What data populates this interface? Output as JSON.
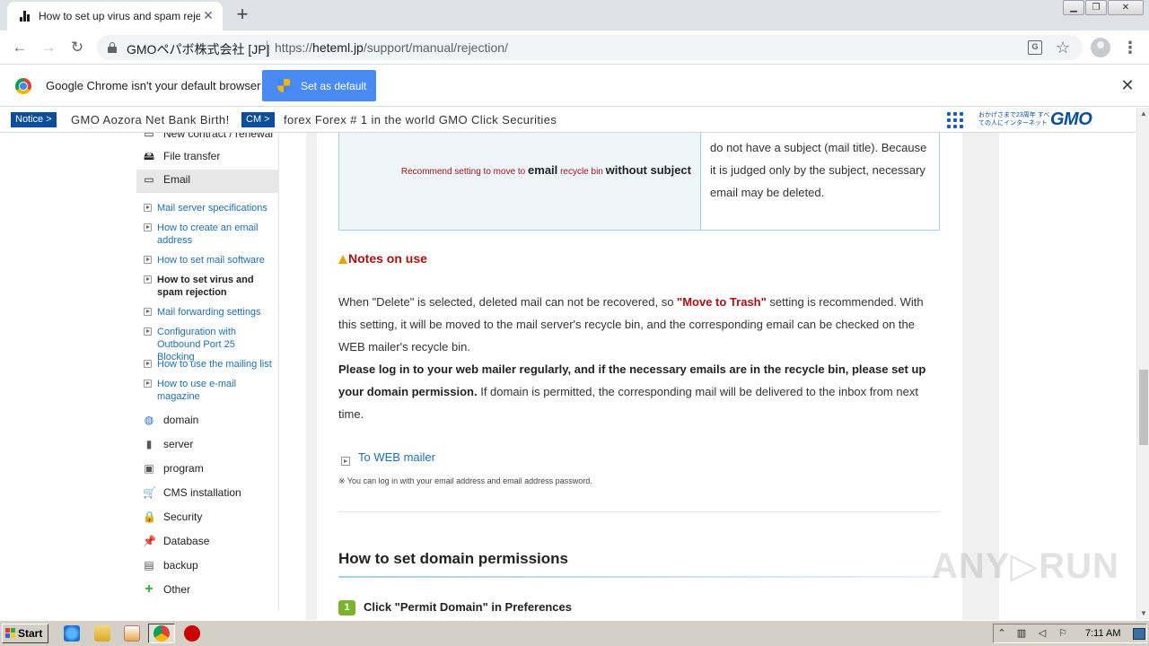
{
  "browser": {
    "tab_title": "How to set up virus and spam rejection",
    "site_owner": "GMOペパボ株式会社 [JP]",
    "url_scheme": "https://",
    "url_host": "heteml.jp",
    "url_path": "/support/manual/rejection/",
    "infobar_message": "Google Chrome isn't your default browser",
    "set_default_label": "Set as default"
  },
  "notice_bar": {
    "tag1": "Notice >",
    "text1": "GMO Aozora Net Bank Birth!",
    "tag2": "CM >",
    "text2": "forex Forex # 1 in the world GMO Click Securities",
    "gmo_tagline": "おかげさまで23周年 すべての人にインターネット",
    "gmo_logo": "GMO"
  },
  "sidebar": {
    "partial_item": "New contract / renewal",
    "main_items": [
      {
        "label": "File transfer",
        "icon": "file-transfer-icon"
      },
      {
        "label": "Email",
        "icon": "email-icon"
      }
    ],
    "sub_items": [
      {
        "label": "Mail server specifications"
      },
      {
        "label": "How to create an email address"
      },
      {
        "label": "How to set mail software"
      },
      {
        "label": "How to set virus and spam rejection",
        "current": true
      },
      {
        "label": "Mail forwarding settings"
      },
      {
        "label": "Configuration with Outbound Port 25 Blocking"
      },
      {
        "label": "How to use the mailing list"
      },
      {
        "label": "How to use e-mail magazine"
      }
    ],
    "bottom_items": [
      {
        "label": "domain"
      },
      {
        "label": "server"
      },
      {
        "label": "program"
      },
      {
        "label": "CMS installation"
      },
      {
        "label": "Security"
      },
      {
        "label": "Database"
      },
      {
        "label": "backup"
      },
      {
        "label": "Other"
      }
    ]
  },
  "content": {
    "rule_left_small1": "Recommend setting to move to",
    "rule_left_big1": "email",
    "rule_left_small2": "recycle bin",
    "rule_left_big2": "without subject",
    "rule_right": "do not have a subject (mail title). Because it is judged only by the subject, necessary email may be deleted.",
    "notes_title": "Notes on use",
    "notes_p1_a": "When \"Delete\" is selected, deleted mail can not be recovered, so ",
    "notes_p1_red": "\"Move to Trash\"",
    "notes_p1_b": " setting is recommended. With this setting, it will be moved to the mail server's recycle bin, and the corresponding email can be checked on the WEB mailer's recycle bin.",
    "notes_p2_bold": "Please log in to your web mailer regularly, and if the necessary emails are in the recycle bin, please set up your domain permission.",
    "notes_p2_rest": " If domain is permitted, the corresponding mail will be delivered to the inbox from next time.",
    "webmailer_link": "To WEB mailer",
    "webmailer_note": "※ You can log in with your email address and email address password.",
    "section_title": "How to set domain permissions",
    "step_number": "1",
    "step_text": "Click \"Permit Domain\" in Preferences"
  },
  "watermark": "ANY▷RUN",
  "taskbar": {
    "start_label": "Start",
    "clock": "7:11 AM"
  }
}
